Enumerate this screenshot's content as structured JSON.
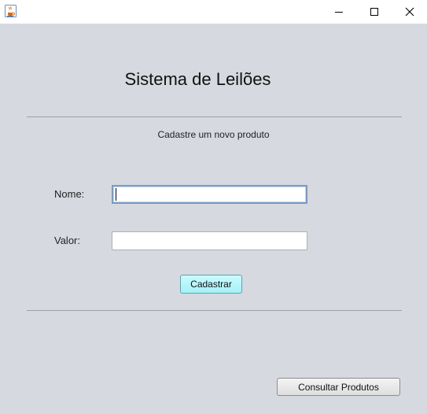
{
  "window": {
    "controls": {
      "minimize_icon": "minimize-icon",
      "maximize_icon": "maximize-icon",
      "close_icon": "close-icon"
    },
    "app_icon": "java-coffee-cup-icon"
  },
  "main": {
    "title": "Sistema de Leilões",
    "subtitle": "Cadastre um novo produto",
    "form": {
      "nome_label": "Nome:",
      "nome_value": "",
      "valor_label": "Valor:",
      "valor_value": ""
    },
    "cadastrar_label": "Cadastrar",
    "consultar_label": "Consultar Produtos"
  },
  "colors": {
    "background": "#d6d9e0",
    "cadastrar_button": "#a6f1f6",
    "focus_border": "#7a9bc2"
  }
}
